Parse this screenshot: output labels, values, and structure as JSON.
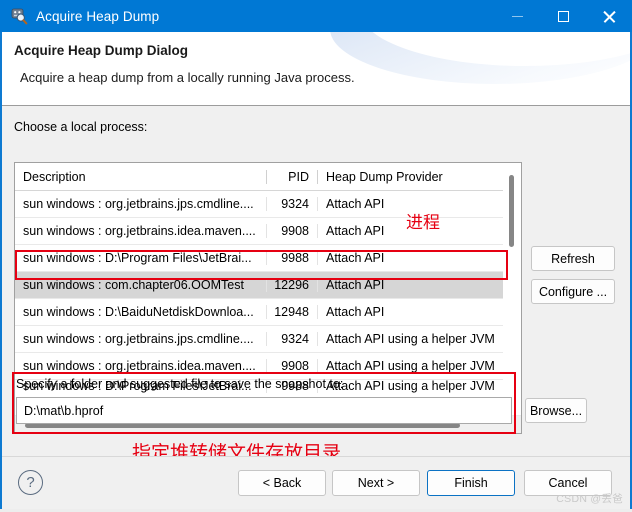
{
  "window": {
    "title": "Acquire Heap Dump",
    "icon": "mat-heap-dump-icon",
    "minimize_label": "—",
    "maximize_label": "□",
    "close_label": "✕"
  },
  "banner": {
    "title": "Acquire Heap Dump Dialog",
    "subtitle": "Acquire a heap dump from a locally running Java process."
  },
  "main": {
    "choose_label": "Choose a local process:",
    "table": {
      "columns": [
        "Description",
        "PID",
        "Heap Dump Provider"
      ],
      "rows": [
        {
          "description": "sun windows : org.jetbrains.jps.cmdline....",
          "pid": "9324",
          "provider": "Attach API",
          "selected": false
        },
        {
          "description": "sun windows : org.jetbrains.idea.maven....",
          "pid": "9908",
          "provider": "Attach API",
          "selected": false
        },
        {
          "description": "sun windows : D:\\Program Files\\JetBrai...",
          "pid": "9988",
          "provider": "Attach API",
          "selected": false
        },
        {
          "description": "sun windows : com.chapter06.OOMTest",
          "pid": "12296",
          "provider": "Attach API",
          "selected": true
        },
        {
          "description": "sun windows : D:\\BaiduNetdiskDownloa...",
          "pid": "12948",
          "provider": "Attach API",
          "selected": false
        },
        {
          "description": "sun windows : org.jetbrains.jps.cmdline....",
          "pid": "9324",
          "provider": "Attach API using a helper JVM",
          "selected": false
        },
        {
          "description": "sun windows : org.jetbrains.idea.maven....",
          "pid": "9908",
          "provider": "Attach API using a helper JVM",
          "selected": false
        },
        {
          "description": "sun windows : D:\\Program Files\\JetBrai...",
          "pid": "9988",
          "provider": "Attach API using a helper JVM",
          "selected": false
        }
      ]
    },
    "refresh_label": "Refresh",
    "configure_label": "Configure ...",
    "folder_label": "Specify a folder and suggested file to save the snapshot to:",
    "path_value": "D:\\mat\\b.hprof",
    "browse_label": "Browse..."
  },
  "annotations": {
    "process_note": "进程",
    "folder_note": "指定堆转储文件存放目录",
    "color": "#e60012"
  },
  "footer": {
    "help_label": "?",
    "back_label": "< Back",
    "next_label": "Next >",
    "finish_label": "Finish",
    "cancel_label": "Cancel",
    "watermark": "CSDN @丢爸"
  },
  "colors": {
    "titlebar": "#0078d4",
    "accent": "#0b72c4",
    "selection": "#d6d6d6",
    "annotation_red": "#e60012"
  }
}
